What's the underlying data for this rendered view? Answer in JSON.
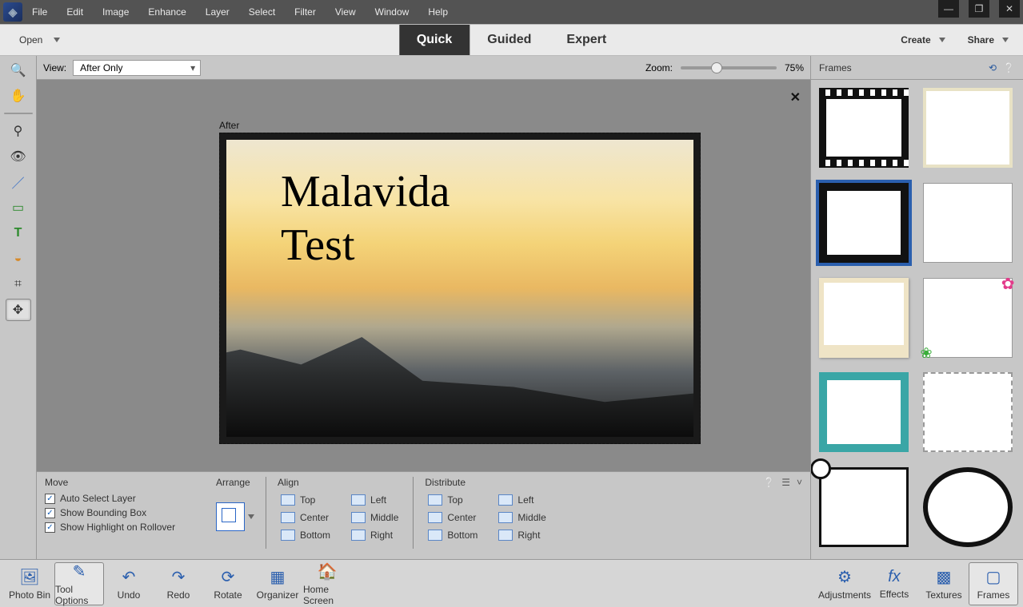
{
  "menubar": {
    "items": [
      "File",
      "Edit",
      "Image",
      "Enhance",
      "Layer",
      "Select",
      "Filter",
      "View",
      "Window",
      "Help"
    ]
  },
  "actionbar": {
    "open": "Open",
    "modes": [
      {
        "label": "Quick",
        "active": true
      },
      {
        "label": "Guided",
        "active": false
      },
      {
        "label": "Expert",
        "active": false
      }
    ],
    "create": "Create",
    "share": "Share"
  },
  "optionsbar": {
    "view_label": "View:",
    "view_value": "After Only",
    "zoom_label": "Zoom:",
    "zoom_value": "75%"
  },
  "canvas": {
    "after_label": "After",
    "text": "Malavida\nTest"
  },
  "bottom_panel": {
    "move": {
      "title": "Move",
      "checks": [
        "Auto Select Layer",
        "Show Bounding Box",
        "Show Highlight on Rollover"
      ]
    },
    "arrange": {
      "title": "Arrange"
    },
    "align": {
      "title": "Align",
      "items": [
        "Top",
        "Center",
        "Bottom",
        "Left",
        "Middle",
        "Right"
      ]
    },
    "distribute": {
      "title": "Distribute",
      "items": [
        "Top",
        "Center",
        "Bottom",
        "Left",
        "Middle",
        "Right"
      ]
    }
  },
  "right_panel": {
    "title": "Frames"
  },
  "footer": {
    "left": [
      "Photo Bin",
      "Tool Options",
      "Undo",
      "Redo",
      "Rotate",
      "Organizer",
      "Home Screen"
    ],
    "right": [
      "Adjustments",
      "Effects",
      "Textures",
      "Frames"
    ]
  },
  "tools": [
    {
      "name": "zoom-tool",
      "glyph": "🔍"
    },
    {
      "name": "hand-tool",
      "glyph": "✋"
    },
    {
      "name": "quick-select-tool",
      "glyph": "🔎"
    },
    {
      "name": "redeye-tool",
      "glyph": "👁"
    },
    {
      "name": "whiten-tool",
      "glyph": "／"
    },
    {
      "name": "straighten-tool",
      "glyph": "📏"
    },
    {
      "name": "text-tool",
      "glyph": "T"
    },
    {
      "name": "healing-tool",
      "glyph": "🩹"
    },
    {
      "name": "crop-tool",
      "glyph": "✂"
    },
    {
      "name": "move-tool",
      "glyph": "✥",
      "selected": true
    }
  ]
}
